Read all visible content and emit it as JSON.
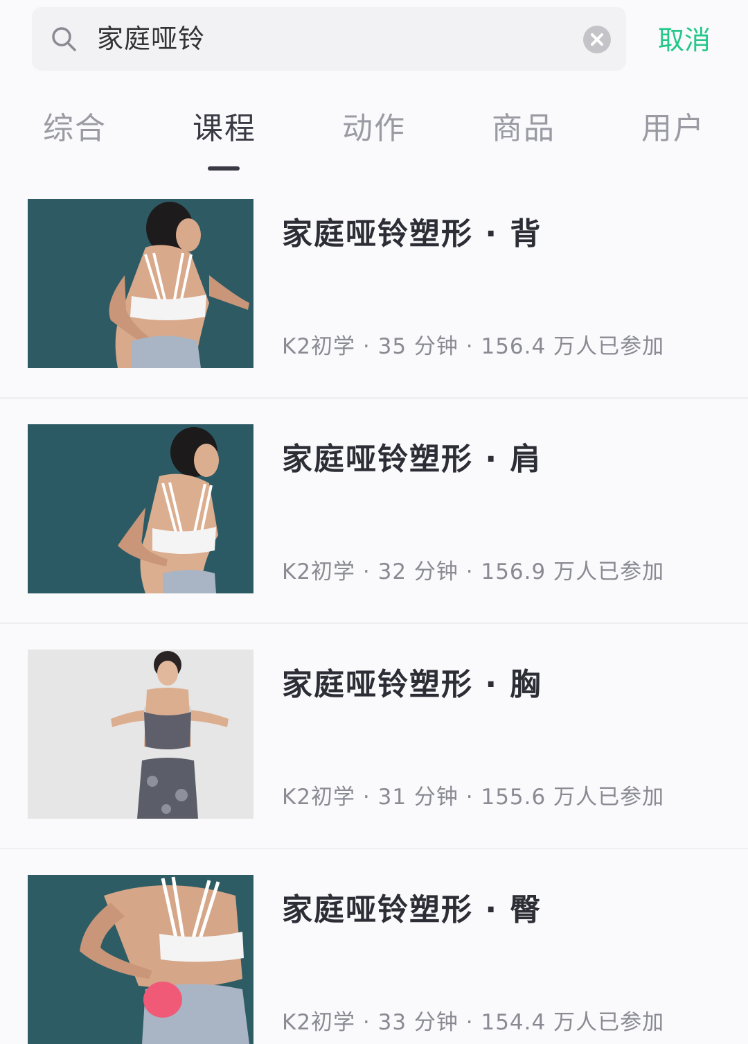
{
  "search": {
    "query": "家庭哑铃",
    "cancel_label": "取消"
  },
  "tabs": [
    {
      "label": "综合"
    },
    {
      "label": "课程"
    },
    {
      "label": "动作"
    },
    {
      "label": "商品"
    },
    {
      "label": "用户"
    }
  ],
  "active_tab": "课程",
  "colors": {
    "accent": "#24c789",
    "active_tab": "#3a3a44",
    "inactive_tab": "#9a9aa3",
    "thumb_bg_teal": "#2e5a63",
    "thumb_bg_light": "#e6e6e6"
  },
  "courses": [
    {
      "title": "家庭哑铃塑形 · 背",
      "meta": "K2初学 · 35 分钟 · 156.4 万人已参加"
    },
    {
      "title": "家庭哑铃塑形 · 肩",
      "meta": "K2初学 · 32 分钟 · 156.9 万人已参加"
    },
    {
      "title": "家庭哑铃塑形 · 胸",
      "meta": "K2初学 · 31 分钟 · 155.6 万人已参加"
    },
    {
      "title": "家庭哑铃塑形 · 臀",
      "meta": "K2初学 · 33 分钟 · 154.4 万人已参加"
    }
  ]
}
